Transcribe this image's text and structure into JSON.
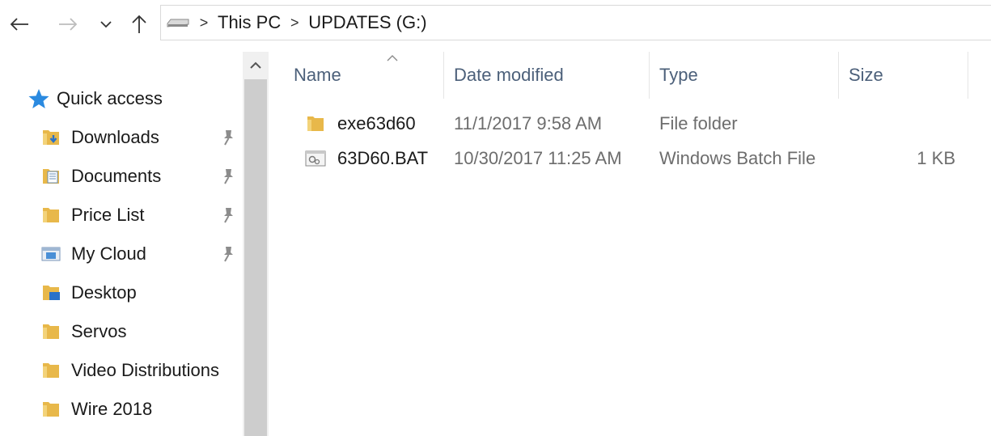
{
  "address_bar": {
    "breadcrumbs": [
      "This PC",
      "UPDATES (G:)"
    ]
  },
  "navigation_pane": {
    "quick_access_label": "Quick access",
    "items": [
      {
        "label": "Downloads",
        "icon": "downloads-folder-icon",
        "pinned": true
      },
      {
        "label": "Documents",
        "icon": "documents-folder-icon",
        "pinned": true
      },
      {
        "label": "Price List",
        "icon": "folder-icon",
        "pinned": true
      },
      {
        "label": "My Cloud",
        "icon": "cloud-drive-icon",
        "pinned": true
      },
      {
        "label": "Desktop",
        "icon": "desktop-folder-icon",
        "pinned": false
      },
      {
        "label": "Servos",
        "icon": "folder-icon",
        "pinned": false
      },
      {
        "label": "Video Distributions",
        "icon": "folder-icon",
        "pinned": false
      },
      {
        "label": "Wire 2018",
        "icon": "folder-icon",
        "pinned": false
      }
    ]
  },
  "file_list": {
    "columns": {
      "name": "Name",
      "date_modified": "Date modified",
      "type": "Type",
      "size": "Size"
    },
    "rows": [
      {
        "name": "exe63d60",
        "date_modified": "11/1/2017 9:58 AM",
        "type": "File folder",
        "size": "",
        "icon": "folder-icon"
      },
      {
        "name": "63D60.BAT",
        "date_modified": "10/30/2017 11:25 AM",
        "type": "Windows Batch File",
        "size": "1 KB",
        "icon": "batch-file-icon"
      }
    ]
  },
  "colors": {
    "folder_yellow": "#e8b84a",
    "header_text": "#4c607a",
    "secondary_text": "#6d6d6d"
  }
}
